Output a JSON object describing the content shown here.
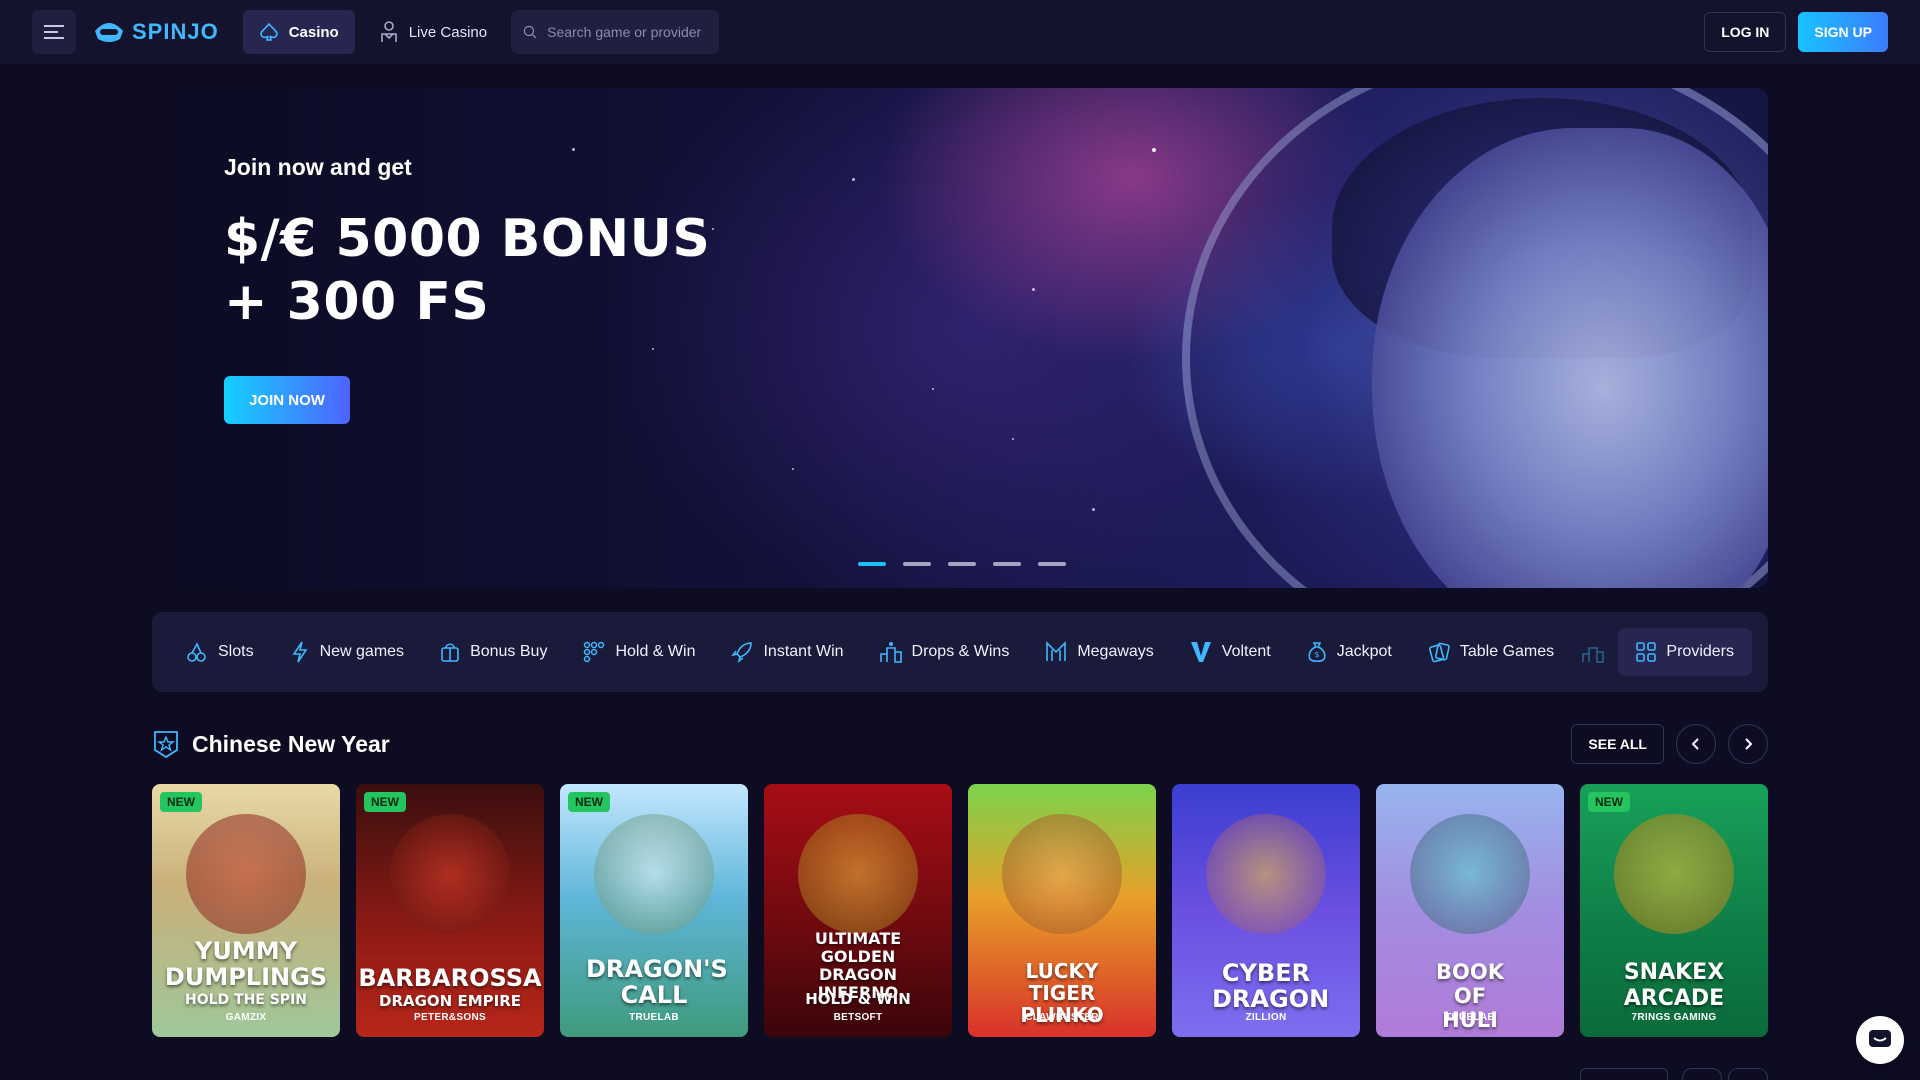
{
  "header": {
    "logo_text": "SPINJO",
    "tabs": [
      {
        "label": "Casino",
        "icon": "spade-icon",
        "active": true
      },
      {
        "label": "Live Casino",
        "icon": "dealer-icon",
        "active": false
      }
    ],
    "search_placeholder": "Search game or provider",
    "login_label": "LOG IN",
    "signup_label": "SIGN UP"
  },
  "banner": {
    "subtitle": "Join now and get",
    "title_line1": "$/€ 5000 BONUS",
    "title_line2": "+ 300 FS",
    "cta_label": "JOIN NOW",
    "slide_count": 5,
    "active_slide": 1
  },
  "categories": [
    {
      "label": "Slots",
      "icon": "cherries-icon"
    },
    {
      "label": "New games",
      "icon": "lightning-icon"
    },
    {
      "label": "Bonus Buy",
      "icon": "gift-bag-icon"
    },
    {
      "label": "Hold & Win",
      "icon": "grid-dots-icon"
    },
    {
      "label": "Instant Win",
      "icon": "rocket-icon"
    },
    {
      "label": "Drops & Wins",
      "icon": "podium-icon"
    },
    {
      "label": "Megaways",
      "icon": "megaways-icon"
    },
    {
      "label": "Voltent",
      "icon": "voltent-v-icon"
    },
    {
      "label": "Jackpot",
      "icon": "money-bag-icon"
    },
    {
      "label": "Table Games",
      "icon": "cards-icon"
    },
    {
      "label": "Providers",
      "icon": "providers-grid-icon"
    }
  ],
  "section": {
    "title": "Chinese New Year",
    "icon": "star-badge-icon",
    "see_all_label": "SEE ALL"
  },
  "games": [
    {
      "title": "YUMMY DUMPLINGS",
      "subtitle": "HOLD THE SPIN",
      "provider": "GAMZIX",
      "is_new": true,
      "badge": "NEW"
    },
    {
      "title": "BARBAROSSA",
      "subtitle": "DRAGON EMPIRE",
      "provider": "PETER&SONS",
      "is_new": true,
      "badge": "NEW"
    },
    {
      "title": "DRAGON'S CALL",
      "subtitle": "",
      "provider": "TRUELAB",
      "is_new": true,
      "badge": "NEW"
    },
    {
      "title": "ULTIMATE GOLDEN DRAGON INFERNO",
      "subtitle": "HOLD & WIN",
      "provider": "BETSOFT",
      "is_new": false,
      "badge": ""
    },
    {
      "title": "LUCKY TIGER PLINKO",
      "subtitle": "",
      "provider": "CLAWBUSTER",
      "is_new": false,
      "badge": ""
    },
    {
      "title": "CYBER DRAGON",
      "subtitle": "",
      "provider": "ZILLION",
      "is_new": false,
      "badge": ""
    },
    {
      "title": "BOOK OF HULI",
      "subtitle": "",
      "provider": "TRUELAB",
      "is_new": false,
      "badge": ""
    },
    {
      "title": "SNAKEX ARCADE",
      "subtitle": "",
      "provider": "7RINGS GAMING",
      "is_new": true,
      "badge": "NEW"
    }
  ],
  "colors": {
    "background": "#0d0c22",
    "header": "#13132e",
    "accent": "#19c2ff",
    "new_badge": "#22c55e"
  }
}
